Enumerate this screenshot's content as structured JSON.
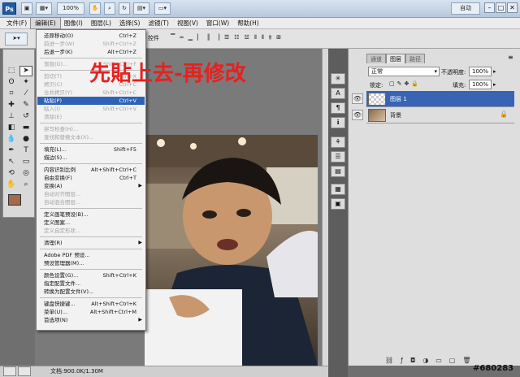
{
  "app": {
    "logo": "Ps",
    "zoom": "100%",
    "workspace": "自动",
    "window_buttons": [
      "–",
      "□",
      "✕"
    ]
  },
  "menubar": [
    "文件(F)",
    "编辑(E)",
    "图像(I)",
    "图层(L)",
    "选择(S)",
    "滤镜(T)",
    "视图(V)",
    "窗口(W)",
    "帮助(H)"
  ],
  "options_bar": {
    "control_label": "控件"
  },
  "edit_menu": {
    "items": [
      {
        "label": "还原移动(O)",
        "shortcut": "Ctrl+Z",
        "state": "enabled"
      },
      {
        "label": "前进一步(W)",
        "shortcut": "Shift+Ctrl+Z",
        "state": "disabled"
      },
      {
        "label": "后退一步(K)",
        "shortcut": "Alt+Ctrl+Z",
        "state": "enabled"
      },
      {
        "sep": true
      },
      {
        "label": "渐隐(D)...",
        "shortcut": "Shift+Ctrl+F",
        "state": "disabled"
      },
      {
        "sep": true
      },
      {
        "label": "剪切(T)",
        "shortcut": "Ctrl+X",
        "state": "disabled"
      },
      {
        "label": "拷贝(C)",
        "shortcut": "Ctrl+C",
        "state": "disabled"
      },
      {
        "label": "合并拷贝(Y)",
        "shortcut": "Shift+Ctrl+C",
        "state": "disabled"
      },
      {
        "label": "粘贴(P)",
        "shortcut": "Ctrl+V",
        "state": "highlighted"
      },
      {
        "label": "贴入(I)",
        "shortcut": "Shift+Ctrl+V",
        "state": "disabled"
      },
      {
        "label": "清除(E)",
        "shortcut": "",
        "state": "disabled"
      },
      {
        "sep": true
      },
      {
        "label": "拼写检查(H)...",
        "shortcut": "",
        "state": "disabled"
      },
      {
        "label": "查找和替换文本(X)...",
        "shortcut": "",
        "state": "disabled"
      },
      {
        "sep": true
      },
      {
        "label": "填充(L)...",
        "shortcut": "Shift+F5",
        "state": "enabled"
      },
      {
        "label": "描边(S)...",
        "shortcut": "",
        "state": "enabled"
      },
      {
        "sep": true
      },
      {
        "label": "内容识别比例",
        "shortcut": "Alt+Shift+Ctrl+C",
        "state": "enabled"
      },
      {
        "label": "自由变换(F)",
        "shortcut": "Ctrl+T",
        "state": "enabled"
      },
      {
        "label": "变换(A)",
        "shortcut": "",
        "state": "enabled",
        "submenu": true
      },
      {
        "label": "自动对齐图层...",
        "shortcut": "",
        "state": "disabled"
      },
      {
        "label": "自动混合图层...",
        "shortcut": "",
        "state": "disabled"
      },
      {
        "sep": true
      },
      {
        "label": "定义画笔预设(B)...",
        "shortcut": "",
        "state": "enabled"
      },
      {
        "label": "定义图案...",
        "shortcut": "",
        "state": "enabled"
      },
      {
        "label": "定义自定形状...",
        "shortcut": "",
        "state": "disabled"
      },
      {
        "sep": true
      },
      {
        "label": "清理(R)",
        "shortcut": "",
        "state": "enabled",
        "submenu": true
      },
      {
        "sep": true
      },
      {
        "label": "Adobe PDF 预设...",
        "shortcut": "",
        "state": "enabled"
      },
      {
        "label": "预设管理器(M)...",
        "shortcut": "",
        "state": "enabled"
      },
      {
        "sep": true
      },
      {
        "label": "颜色设置(G)...",
        "shortcut": "Shift+Ctrl+K",
        "state": "enabled"
      },
      {
        "label": "指定配置文件...",
        "shortcut": "",
        "state": "enabled"
      },
      {
        "label": "转换为配置文件(V)...",
        "shortcut": "",
        "state": "enabled"
      },
      {
        "sep": true
      },
      {
        "label": "键盘快捷键...",
        "shortcut": "Alt+Shift+Ctrl+K",
        "state": "enabled"
      },
      {
        "label": "菜单(U)...",
        "shortcut": "Alt+Shift+Ctrl+M",
        "state": "enabled"
      },
      {
        "label": "首选项(N)",
        "shortcut": "",
        "state": "enabled",
        "submenu": true
      }
    ]
  },
  "annotation": "先貼上去-再修改",
  "doc_status": "文档:900.0K/1.30M",
  "layers_panel": {
    "tabs": [
      "图层",
      "通道",
      "路径"
    ],
    "active_tab": "图层",
    "blend_mode": "正常",
    "opacity_label": "不透明度:",
    "opacity_value": "100%",
    "lock_label": "锁定:",
    "fill_label": "填充:",
    "fill_value": "100%",
    "layers": [
      {
        "name": "图层 1",
        "selected": true,
        "visible": true
      },
      {
        "name": "背景",
        "selected": false,
        "visible": true,
        "locked": true
      }
    ]
  },
  "watermark": "#680283",
  "colors": {
    "foreground": "#a4684a",
    "background": "#3a2fd9",
    "highlight": "#2f62b7",
    "annotation": "#e8201e"
  }
}
